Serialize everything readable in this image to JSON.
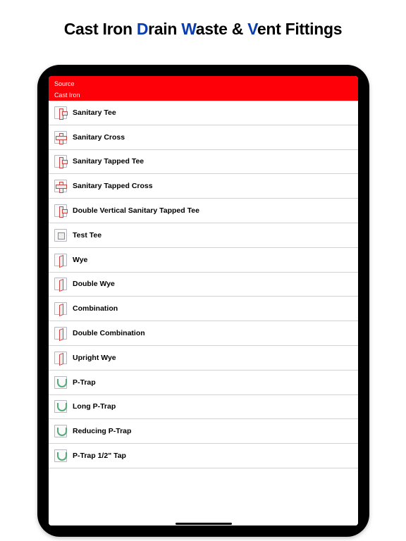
{
  "promo": {
    "prefix": "Cast Iron ",
    "w1_letter": "D",
    "w1_rest": "rain ",
    "w2_letter": "W",
    "w2_rest": "aste & ",
    "w3_letter": "V",
    "w3_rest": "ent Fittings"
  },
  "header": {
    "back_label": "Source",
    "subtitle": "Cast Iron"
  },
  "items": [
    {
      "label": "Sanitary Tee",
      "icon": "t-tee"
    },
    {
      "label": "Sanitary Cross",
      "icon": "t-cross"
    },
    {
      "label": "Sanitary Tapped Tee",
      "icon": "t-tee"
    },
    {
      "label": "Sanitary Tapped Cross",
      "icon": "t-cross"
    },
    {
      "label": "Double Vertical Sanitary Tapped Tee",
      "icon": "t-tee"
    },
    {
      "label": "Test Tee",
      "icon": "t-gen"
    },
    {
      "label": "Wye",
      "icon": "t-wye"
    },
    {
      "label": "Double Wye",
      "icon": "t-wye"
    },
    {
      "label": "Combination",
      "icon": "t-wye"
    },
    {
      "label": "Double Combination",
      "icon": "t-wye"
    },
    {
      "label": "Upright Wye",
      "icon": "t-wye"
    },
    {
      "label": "P-Trap",
      "icon": "t-trap"
    },
    {
      "label": "Long P-Trap",
      "icon": "t-trap"
    },
    {
      "label": "Reducing P-Trap",
      "icon": "t-trap"
    },
    {
      "label": "P-Trap 1/2\" Tap",
      "icon": "t-trap"
    }
  ]
}
